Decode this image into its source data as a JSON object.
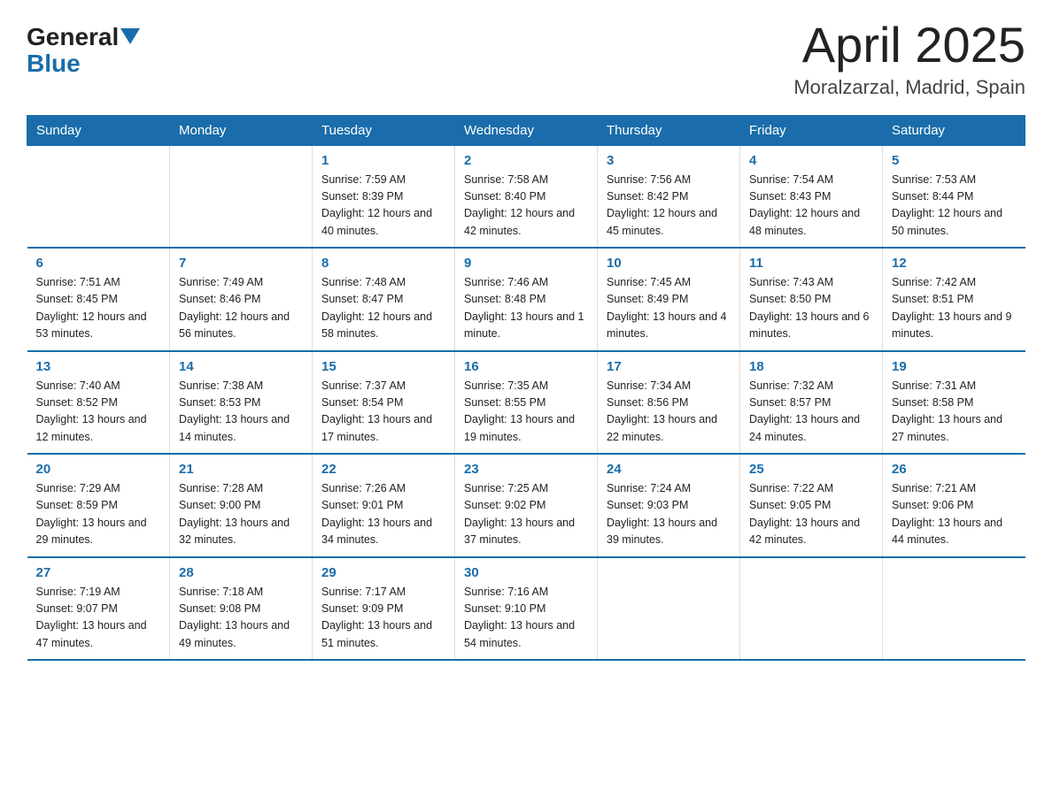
{
  "logo": {
    "general": "General",
    "blue": "Blue",
    "arrow": "▼"
  },
  "title": "April 2025",
  "subtitle": "Moralzarzal, Madrid, Spain",
  "weekdays": [
    "Sunday",
    "Monday",
    "Tuesday",
    "Wednesday",
    "Thursday",
    "Friday",
    "Saturday"
  ],
  "weeks": [
    [
      {
        "num": "",
        "info": ""
      },
      {
        "num": "",
        "info": ""
      },
      {
        "num": "1",
        "info": "Sunrise: 7:59 AM\nSunset: 8:39 PM\nDaylight: 12 hours\nand 40 minutes."
      },
      {
        "num": "2",
        "info": "Sunrise: 7:58 AM\nSunset: 8:40 PM\nDaylight: 12 hours\nand 42 minutes."
      },
      {
        "num": "3",
        "info": "Sunrise: 7:56 AM\nSunset: 8:42 PM\nDaylight: 12 hours\nand 45 minutes."
      },
      {
        "num": "4",
        "info": "Sunrise: 7:54 AM\nSunset: 8:43 PM\nDaylight: 12 hours\nand 48 minutes."
      },
      {
        "num": "5",
        "info": "Sunrise: 7:53 AM\nSunset: 8:44 PM\nDaylight: 12 hours\nand 50 minutes."
      }
    ],
    [
      {
        "num": "6",
        "info": "Sunrise: 7:51 AM\nSunset: 8:45 PM\nDaylight: 12 hours\nand 53 minutes."
      },
      {
        "num": "7",
        "info": "Sunrise: 7:49 AM\nSunset: 8:46 PM\nDaylight: 12 hours\nand 56 minutes."
      },
      {
        "num": "8",
        "info": "Sunrise: 7:48 AM\nSunset: 8:47 PM\nDaylight: 12 hours\nand 58 minutes."
      },
      {
        "num": "9",
        "info": "Sunrise: 7:46 AM\nSunset: 8:48 PM\nDaylight: 13 hours\nand 1 minute."
      },
      {
        "num": "10",
        "info": "Sunrise: 7:45 AM\nSunset: 8:49 PM\nDaylight: 13 hours\nand 4 minutes."
      },
      {
        "num": "11",
        "info": "Sunrise: 7:43 AM\nSunset: 8:50 PM\nDaylight: 13 hours\nand 6 minutes."
      },
      {
        "num": "12",
        "info": "Sunrise: 7:42 AM\nSunset: 8:51 PM\nDaylight: 13 hours\nand 9 minutes."
      }
    ],
    [
      {
        "num": "13",
        "info": "Sunrise: 7:40 AM\nSunset: 8:52 PM\nDaylight: 13 hours\nand 12 minutes."
      },
      {
        "num": "14",
        "info": "Sunrise: 7:38 AM\nSunset: 8:53 PM\nDaylight: 13 hours\nand 14 minutes."
      },
      {
        "num": "15",
        "info": "Sunrise: 7:37 AM\nSunset: 8:54 PM\nDaylight: 13 hours\nand 17 minutes."
      },
      {
        "num": "16",
        "info": "Sunrise: 7:35 AM\nSunset: 8:55 PM\nDaylight: 13 hours\nand 19 minutes."
      },
      {
        "num": "17",
        "info": "Sunrise: 7:34 AM\nSunset: 8:56 PM\nDaylight: 13 hours\nand 22 minutes."
      },
      {
        "num": "18",
        "info": "Sunrise: 7:32 AM\nSunset: 8:57 PM\nDaylight: 13 hours\nand 24 minutes."
      },
      {
        "num": "19",
        "info": "Sunrise: 7:31 AM\nSunset: 8:58 PM\nDaylight: 13 hours\nand 27 minutes."
      }
    ],
    [
      {
        "num": "20",
        "info": "Sunrise: 7:29 AM\nSunset: 8:59 PM\nDaylight: 13 hours\nand 29 minutes."
      },
      {
        "num": "21",
        "info": "Sunrise: 7:28 AM\nSunset: 9:00 PM\nDaylight: 13 hours\nand 32 minutes."
      },
      {
        "num": "22",
        "info": "Sunrise: 7:26 AM\nSunset: 9:01 PM\nDaylight: 13 hours\nand 34 minutes."
      },
      {
        "num": "23",
        "info": "Sunrise: 7:25 AM\nSunset: 9:02 PM\nDaylight: 13 hours\nand 37 minutes."
      },
      {
        "num": "24",
        "info": "Sunrise: 7:24 AM\nSunset: 9:03 PM\nDaylight: 13 hours\nand 39 minutes."
      },
      {
        "num": "25",
        "info": "Sunrise: 7:22 AM\nSunset: 9:05 PM\nDaylight: 13 hours\nand 42 minutes."
      },
      {
        "num": "26",
        "info": "Sunrise: 7:21 AM\nSunset: 9:06 PM\nDaylight: 13 hours\nand 44 minutes."
      }
    ],
    [
      {
        "num": "27",
        "info": "Sunrise: 7:19 AM\nSunset: 9:07 PM\nDaylight: 13 hours\nand 47 minutes."
      },
      {
        "num": "28",
        "info": "Sunrise: 7:18 AM\nSunset: 9:08 PM\nDaylight: 13 hours\nand 49 minutes."
      },
      {
        "num": "29",
        "info": "Sunrise: 7:17 AM\nSunset: 9:09 PM\nDaylight: 13 hours\nand 51 minutes."
      },
      {
        "num": "30",
        "info": "Sunrise: 7:16 AM\nSunset: 9:10 PM\nDaylight: 13 hours\nand 54 minutes."
      },
      {
        "num": "",
        "info": ""
      },
      {
        "num": "",
        "info": ""
      },
      {
        "num": "",
        "info": ""
      }
    ]
  ]
}
